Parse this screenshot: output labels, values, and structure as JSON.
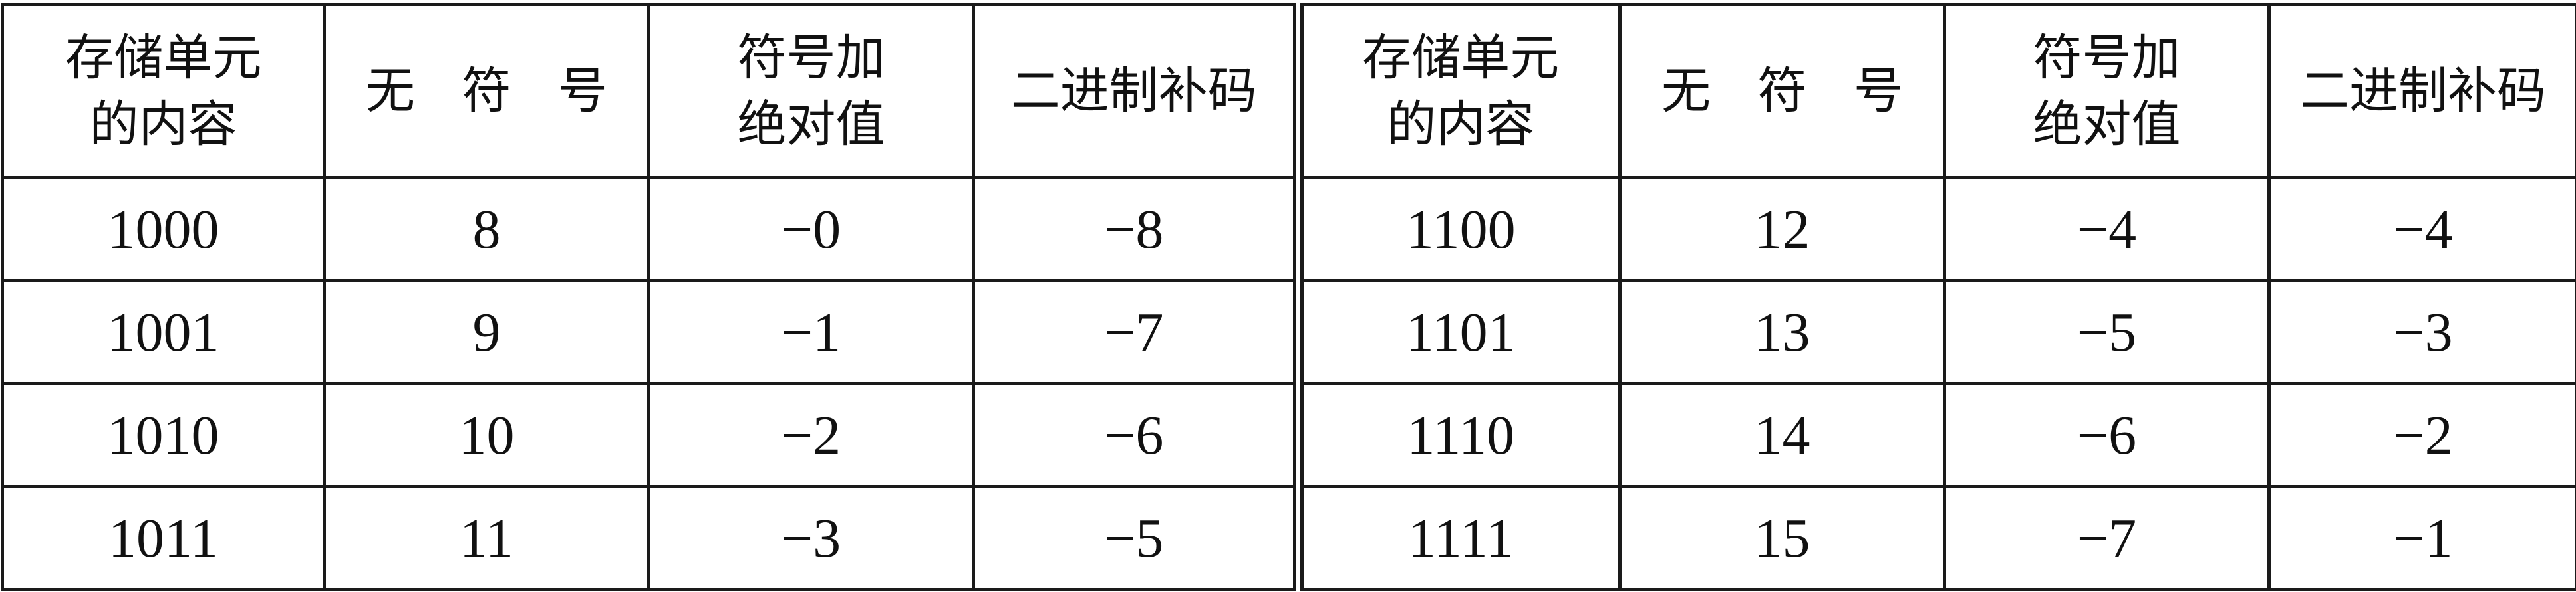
{
  "headers": {
    "content": [
      "存储单元",
      "的内容"
    ],
    "unsigned": [
      "无",
      "符",
      "号"
    ],
    "sign_magnitude": [
      "符号加",
      "绝对值"
    ],
    "twos_complement": "二进制补码"
  },
  "rows_left": [
    {
      "content": "1000",
      "unsigned": "8",
      "sign_magnitude": "−0",
      "twos_complement": "−8"
    },
    {
      "content": "1001",
      "unsigned": "9",
      "sign_magnitude": "−1",
      "twos_complement": "−7"
    },
    {
      "content": "1010",
      "unsigned": "10",
      "sign_magnitude": "−2",
      "twos_complement": "−6"
    },
    {
      "content": "1011",
      "unsigned": "11",
      "sign_magnitude": "−3",
      "twos_complement": "−5"
    }
  ],
  "rows_right": [
    {
      "content": "1100",
      "unsigned": "12",
      "sign_magnitude": "−4",
      "twos_complement": "−4"
    },
    {
      "content": "1101",
      "unsigned": "13",
      "sign_magnitude": "−5",
      "twos_complement": "−3"
    },
    {
      "content": "1110",
      "unsigned": "14",
      "sign_magnitude": "−6",
      "twos_complement": "−2"
    },
    {
      "content": "1111",
      "unsigned": "15",
      "sign_magnitude": "−7",
      "twos_complement": "−1"
    }
  ]
}
